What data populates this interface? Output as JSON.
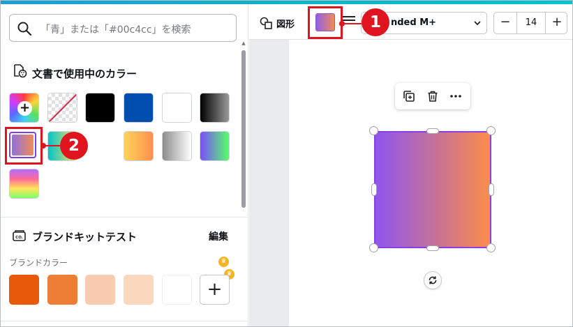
{
  "search": {
    "placeholder": "「青」または「#00c4cc」を検索"
  },
  "doc_colors": {
    "title": "文書で使用中のカラー",
    "swatches": [
      {
        "name": "add-color",
        "type": "rainbow-plus"
      },
      {
        "name": "transparent",
        "type": "transparent"
      },
      {
        "name": "black",
        "gradient": "#000000"
      },
      {
        "name": "blue",
        "gradient": "#004fb0"
      },
      {
        "name": "white",
        "gradient": "#ffffff"
      },
      {
        "name": "black-gradient",
        "gradient": "linear-gradient(90deg,#000000,#9a9a9a)"
      },
      {
        "name": "purple-orange-gradient",
        "gradient": "linear-gradient(90deg,#9070e0,#f08a58)",
        "selected": true
      },
      {
        "name": "cyan-yellow-gradient",
        "gradient": "linear-gradient(90deg,#00c4cc,#ffe35c)"
      },
      {
        "name": "yellow-orange-gradient",
        "gradient": "linear-gradient(90deg,#ffd35a,#ff8f4e)"
      },
      {
        "name": "gray-gradient",
        "gradient": "linear-gradient(90deg,#8c8c8c,#ffffff)"
      },
      {
        "name": "purple-green-gradient",
        "gradient": "linear-gradient(90deg,#7b4dff,#55ff6a)"
      },
      {
        "name": "multicolor-gradient",
        "gradient": "linear-gradient(180deg,#b06cff,#ff6a9a,#ffe65a,#7cff6a)"
      }
    ]
  },
  "brand_kit": {
    "title": "ブランドキットテスト",
    "edit_label": "編集",
    "colors_label": "ブランドカラー",
    "colors": [
      "#e8590c",
      "#ee7d36",
      "#f9ccb2",
      "#fad7bd",
      "#ffffff"
    ],
    "add_label": "+",
    "crown_glyph": "♛"
  },
  "toolbar": {
    "shape_label": "図形",
    "font_name": "nded M+",
    "font_size": "14",
    "minus_label": "−",
    "plus_label": "+"
  },
  "annotations": {
    "badge1": "1",
    "badge2": "2",
    "highlight_color": "#e0141e"
  },
  "shape": {
    "fill_start": "#8f56ef",
    "fill_end": "#fc8d4a"
  }
}
